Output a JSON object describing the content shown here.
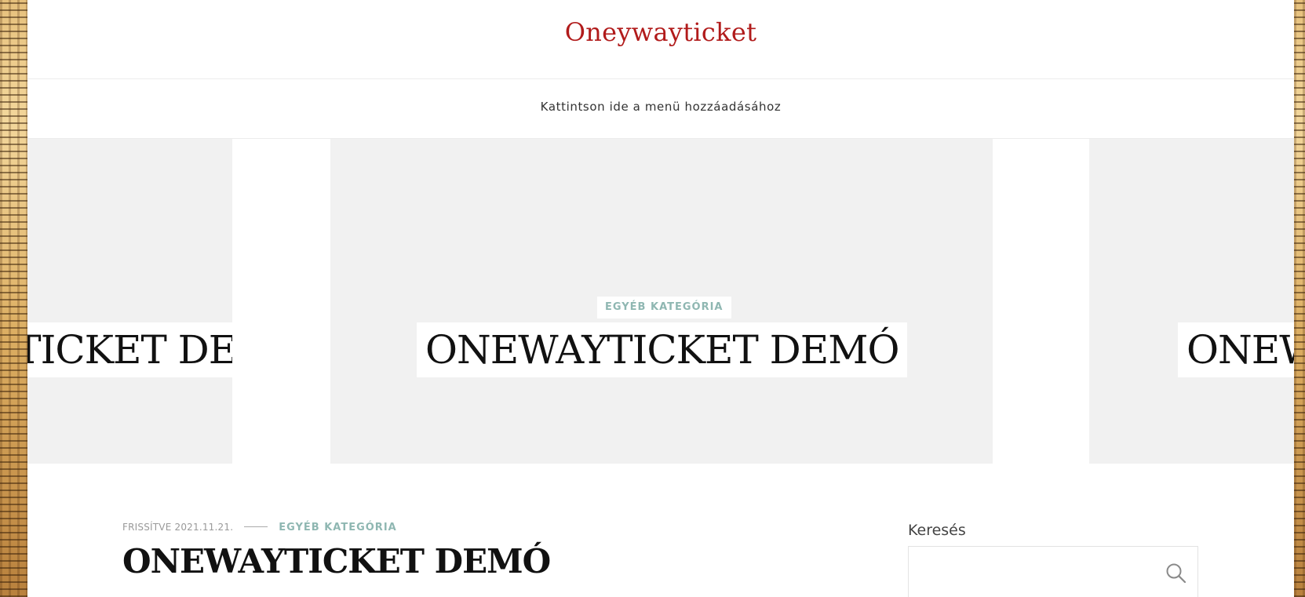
{
  "site": {
    "title": "Oneywayticket"
  },
  "nav": {
    "add_menu_label": "Kattintson ide a menü hozzáadásához"
  },
  "slider": {
    "slides": [
      {
        "category": "",
        "title": "ONEWAYTICKET DEMÓ"
      },
      {
        "category": "EGYÉB KATEGÓRIA",
        "title": "ONEWAYTICKET DEMÓ"
      },
      {
        "category": "",
        "title": "ONEWAYTICKET DEMÓ"
      }
    ]
  },
  "post": {
    "updated": "FRISSÍTVE 2021.11.21.",
    "category": "EGYÉB KATEGÓRIA",
    "title": "ONEWAYTICKET DEMÓ"
  },
  "sidebar": {
    "search_title": "Keresés",
    "search_value": "",
    "search_icon": "search-icon"
  },
  "colors": {
    "site_title": "#b11b1b",
    "category_accent": "#8fb7b2",
    "slide_bg": "#f1f1f1"
  }
}
